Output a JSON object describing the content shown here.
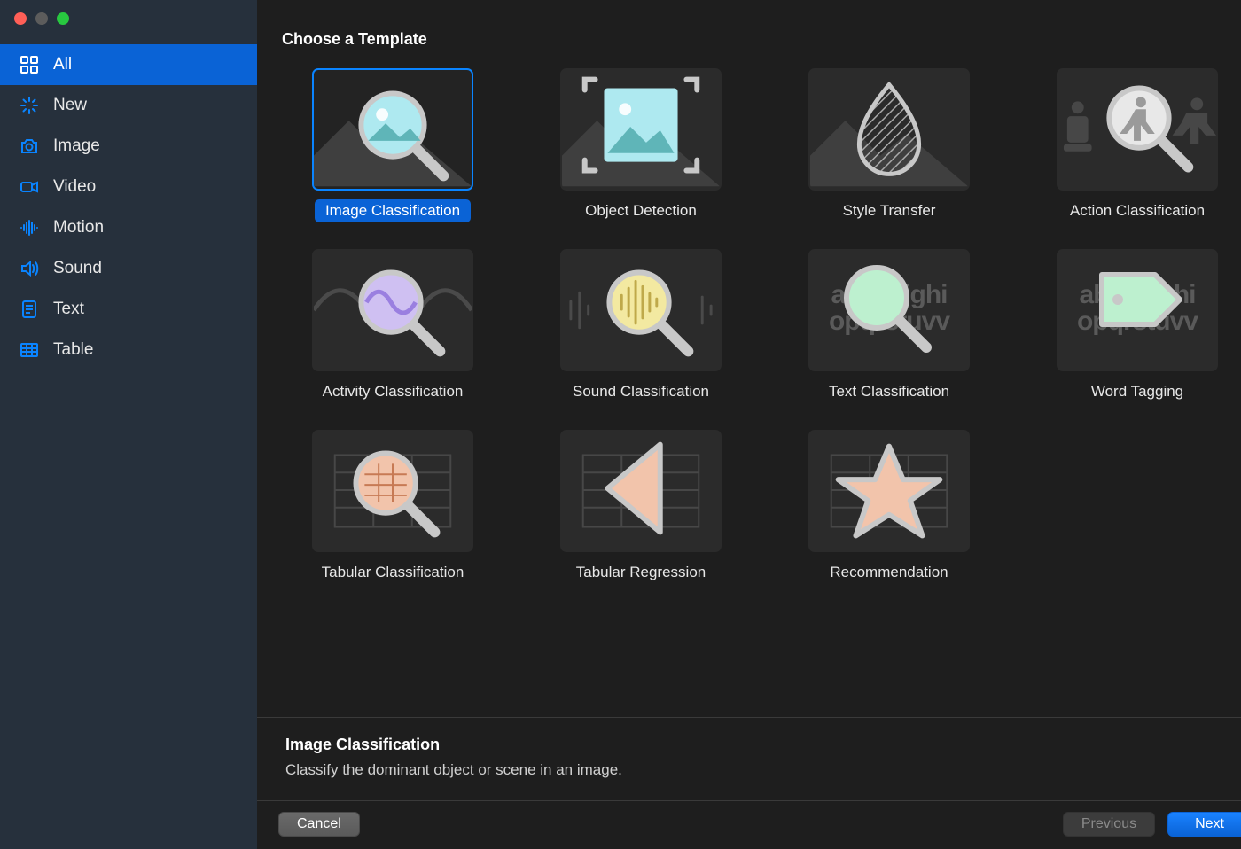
{
  "header": {
    "title": "Choose a Template"
  },
  "sidebar": {
    "items": [
      {
        "id": "all",
        "label": "All",
        "selected": true
      },
      {
        "id": "new",
        "label": "New"
      },
      {
        "id": "image",
        "label": "Image"
      },
      {
        "id": "video",
        "label": "Video"
      },
      {
        "id": "motion",
        "label": "Motion"
      },
      {
        "id": "sound",
        "label": "Sound"
      },
      {
        "id": "text",
        "label": "Text"
      },
      {
        "id": "table",
        "label": "Table"
      }
    ]
  },
  "templates": [
    {
      "id": "image-classification",
      "label": "Image Classification",
      "selected": true
    },
    {
      "id": "object-detection",
      "label": "Object Detection"
    },
    {
      "id": "style-transfer",
      "label": "Style Transfer"
    },
    {
      "id": "action-classification",
      "label": "Action Classification"
    },
    {
      "id": "activity-classification",
      "label": "Activity Classification"
    },
    {
      "id": "sound-classification",
      "label": "Sound Classification"
    },
    {
      "id": "text-classification",
      "label": "Text Classification"
    },
    {
      "id": "word-tagging",
      "label": "Word Tagging"
    },
    {
      "id": "tabular-classification",
      "label": "Tabular Classification"
    },
    {
      "id": "tabular-regression",
      "label": "Tabular Regression"
    },
    {
      "id": "recommendation",
      "label": "Recommendation"
    }
  ],
  "info": {
    "title": "Image Classification",
    "description": "Classify the dominant object or scene in an image."
  },
  "footer": {
    "cancel": "Cancel",
    "previous": "Previous",
    "next": "Next"
  }
}
